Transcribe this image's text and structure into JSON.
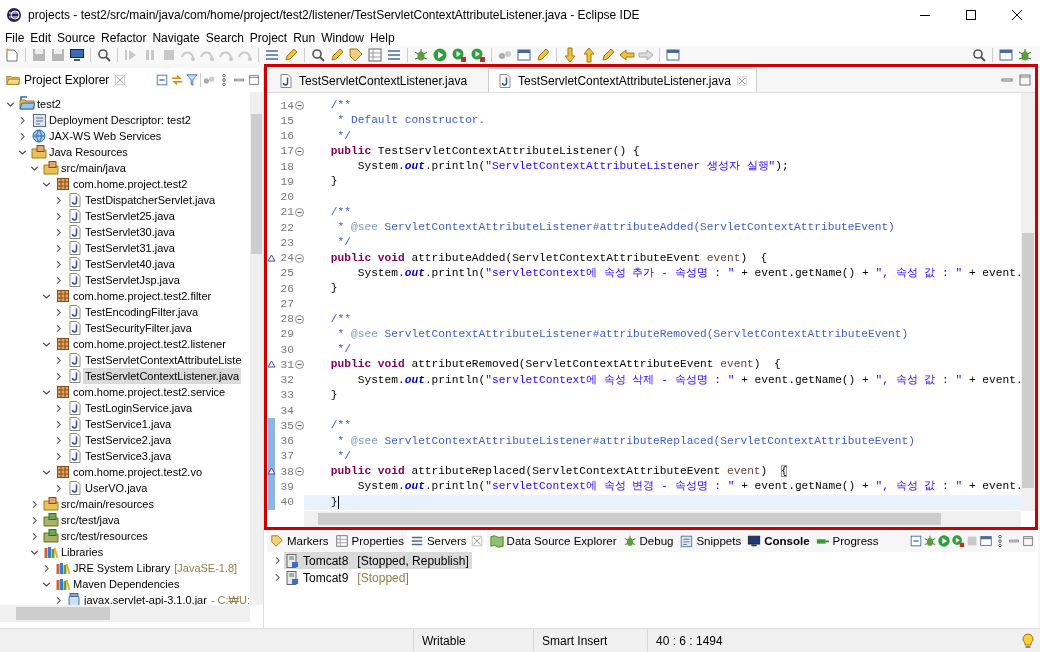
{
  "window": {
    "title": "projects - test2/src/main/java/com/home/project/test2/listener/TestServletContextAttributeListener.java - Eclipse IDE"
  },
  "menu": [
    "File",
    "Edit",
    "Source",
    "Refactor",
    "Navigate",
    "Search",
    "Project",
    "Run",
    "Window",
    "Help"
  ],
  "project_explorer": {
    "title": "Project Explorer",
    "tree": [
      {
        "label": "test2",
        "kind": "project",
        "expanded": true,
        "selected": false,
        "children": [
          {
            "label": "Deployment Descriptor: test2",
            "kind": "descriptor",
            "expanded": false,
            "selected": false
          },
          {
            "label": "JAX-WS Web Services",
            "kind": "webservices",
            "expanded": false,
            "selected": false
          },
          {
            "label": "Java Resources",
            "kind": "resources",
            "expanded": true,
            "selected": false,
            "children": [
              {
                "label": "src/main/java",
                "kind": "source-folder",
                "expanded": true,
                "selected": false,
                "children": [
                  {
                    "label": "com.home.project.test2",
                    "kind": "package",
                    "expanded": true,
                    "selected": false,
                    "children": [
                      {
                        "label": "TestDispatcherServlet.java",
                        "kind": "java",
                        "expanded": false,
                        "selected": false
                      },
                      {
                        "label": "TestServlet25.java",
                        "kind": "java",
                        "expanded": false,
                        "selected": false
                      },
                      {
                        "label": "TestServlet30.java",
                        "kind": "java",
                        "expanded": false,
                        "selected": false
                      },
                      {
                        "label": "TestServlet31.java",
                        "kind": "java",
                        "expanded": false,
                        "selected": false
                      },
                      {
                        "label": "TestServlet40.java",
                        "kind": "java",
                        "expanded": false,
                        "selected": false
                      },
                      {
                        "label": "TestServletJsp.java",
                        "kind": "java",
                        "expanded": false,
                        "selected": false
                      }
                    ]
                  },
                  {
                    "label": "com.home.project.test2.filter",
                    "kind": "package",
                    "expanded": true,
                    "selected": false,
                    "children": [
                      {
                        "label": "TestEncodingFilter.java",
                        "kind": "java",
                        "expanded": false,
                        "selected": false
                      },
                      {
                        "label": "TestSecurityFilter.java",
                        "kind": "java",
                        "expanded": false,
                        "selected": false
                      }
                    ]
                  },
                  {
                    "label": "com.home.project.test2.listener",
                    "kind": "package",
                    "expanded": true,
                    "selected": false,
                    "children": [
                      {
                        "label": "TestServletContextAttributeListe",
                        "kind": "java",
                        "expanded": false,
                        "selected": false
                      },
                      {
                        "label": "TestServletContextListener.java",
                        "kind": "java",
                        "expanded": false,
                        "selected": true
                      }
                    ]
                  },
                  {
                    "label": "com.home.project.test2.service",
                    "kind": "package",
                    "expanded": true,
                    "selected": false,
                    "children": [
                      {
                        "label": "TestLoginService.java",
                        "kind": "java",
                        "expanded": false,
                        "selected": false
                      },
                      {
                        "label": "TestService1.java",
                        "kind": "java",
                        "expanded": false,
                        "selected": false
                      },
                      {
                        "label": "TestService2.java",
                        "kind": "java",
                        "expanded": false,
                        "selected": false
                      },
                      {
                        "label": "TestService3.java",
                        "kind": "java",
                        "expanded": false,
                        "selected": false
                      }
                    ]
                  },
                  {
                    "label": "com.home.project.test2.vo",
                    "kind": "package",
                    "expanded": true,
                    "selected": false,
                    "children": [
                      {
                        "label": "UserVO.java",
                        "kind": "java",
                        "expanded": false,
                        "selected": false
                      }
                    ]
                  }
                ]
              },
              {
                "label": "src/main/resources",
                "kind": "source-folder",
                "expanded": false,
                "selected": false
              },
              {
                "label": "src/test/java",
                "kind": "test-folder",
                "expanded": false,
                "selected": false
              },
              {
                "label": "src/test/resources",
                "kind": "test-folder",
                "expanded": false,
                "selected": false
              },
              {
                "label": "Libraries",
                "kind": "libraries",
                "expanded": true,
                "selected": false,
                "children": [
                  {
                    "label": "JRE System Library",
                    "decoration": "[JavaSE-1.8]",
                    "kind": "library",
                    "expanded": false,
                    "selected": false
                  },
                  {
                    "label": "Maven Dependencies",
                    "kind": "library",
                    "expanded": true,
                    "selected": false,
                    "children": [
                      {
                        "label": "javax.servlet-api-3.1.0.jar",
                        "decoration": "- C:₩U:",
                        "kind": "jar",
                        "expanded": false,
                        "selected": false
                      }
                    ]
                  }
                ]
              }
            ]
          }
        ]
      }
    ]
  },
  "editor": {
    "tabs": [
      {
        "label": "TestServletContextListener.java",
        "selected": false
      },
      {
        "label": "TestServletContextAttributeListener.java",
        "selected": true
      }
    ],
    "lines": [
      {
        "number": "14",
        "foldable": true,
        "override": false,
        "changed": false,
        "current": false,
        "tokens": [
          {
            "kind": "comment",
            "text": "    /**"
          }
        ]
      },
      {
        "number": "15",
        "foldable": false,
        "override": false,
        "changed": false,
        "current": false,
        "tokens": [
          {
            "kind": "comment",
            "text": "     * Default constructor."
          }
        ]
      },
      {
        "number": "16",
        "foldable": false,
        "override": false,
        "changed": false,
        "current": false,
        "tokens": [
          {
            "kind": "comment",
            "text": "     */"
          }
        ]
      },
      {
        "number": "17",
        "foldable": true,
        "override": false,
        "changed": false,
        "current": false,
        "tokens": [
          {
            "kind": "keyword",
            "text": "    public"
          },
          {
            "kind": "plain",
            "text": " TestServletContextAttributeListener() {"
          }
        ]
      },
      {
        "number": "18",
        "foldable": false,
        "override": false,
        "changed": false,
        "current": false,
        "tokens": [
          {
            "kind": "plain",
            "text": "        System."
          },
          {
            "kind": "static",
            "text": "out"
          },
          {
            "kind": "plain",
            "text": ".println("
          },
          {
            "kind": "string",
            "text": "\"ServletContextAttributeListener 생성자 실행\""
          },
          {
            "kind": "plain",
            "text": ");"
          }
        ]
      },
      {
        "number": "19",
        "foldable": false,
        "override": false,
        "changed": false,
        "current": false,
        "tokens": [
          {
            "kind": "plain",
            "text": "    }"
          }
        ]
      },
      {
        "number": "20",
        "foldable": false,
        "override": false,
        "changed": false,
        "current": false
      },
      {
        "number": "21",
        "foldable": true,
        "override": false,
        "changed": false,
        "current": false,
        "tokens": [
          {
            "kind": "comment",
            "text": "    /**"
          }
        ]
      },
      {
        "number": "22",
        "foldable": false,
        "override": false,
        "changed": false,
        "current": false,
        "tokens": [
          {
            "kind": "comment",
            "text": "     * "
          },
          {
            "kind": "doc-tag",
            "text": "@see"
          },
          {
            "kind": "comment",
            "text": " ServletContextAttributeListener#attributeAdded(ServletContextAttributeEvent)"
          }
        ]
      },
      {
        "number": "23",
        "foldable": false,
        "override": false,
        "changed": false,
        "current": false,
        "tokens": [
          {
            "kind": "comment",
            "text": "     */"
          }
        ]
      },
      {
        "number": "24",
        "foldable": true,
        "override": true,
        "changed": false,
        "current": false,
        "tokens": [
          {
            "kind": "keyword",
            "text": "    public void"
          },
          {
            "kind": "plain",
            "text": " attributeAdded(ServletContextAttributeEvent "
          },
          {
            "kind": "param",
            "text": "event"
          },
          {
            "kind": "plain",
            "text": ")  {"
          }
        ]
      },
      {
        "number": "25",
        "foldable": false,
        "override": false,
        "changed": false,
        "current": false,
        "tokens": [
          {
            "kind": "plain",
            "text": "        System."
          },
          {
            "kind": "static",
            "text": "out"
          },
          {
            "kind": "plain",
            "text": ".println("
          },
          {
            "kind": "string",
            "text": "\"servletContext에 속성 추가 - 속성명 : \""
          },
          {
            "kind": "plain",
            "text": " + event.getName() + "
          },
          {
            "kind": "string",
            "text": "\", 속성 값 : \""
          },
          {
            "kind": "plain",
            "text": " + event."
          }
        ]
      },
      {
        "number": "26",
        "foldable": false,
        "override": false,
        "changed": false,
        "current": false,
        "tokens": [
          {
            "kind": "plain",
            "text": "    }"
          }
        ]
      },
      {
        "number": "27",
        "foldable": false,
        "override": false,
        "changed": false,
        "current": false
      },
      {
        "number": "28",
        "foldable": true,
        "override": false,
        "changed": false,
        "current": false,
        "tokens": [
          {
            "kind": "comment",
            "text": "    /**"
          }
        ]
      },
      {
        "number": "29",
        "foldable": false,
        "override": false,
        "changed": false,
        "current": false,
        "tokens": [
          {
            "kind": "comment",
            "text": "     * "
          },
          {
            "kind": "doc-tag",
            "text": "@see"
          },
          {
            "kind": "comment",
            "text": " ServletContextAttributeListener#attributeRemoved(ServletContextAttributeEvent)"
          }
        ]
      },
      {
        "number": "30",
        "foldable": false,
        "override": false,
        "changed": false,
        "current": false,
        "tokens": [
          {
            "kind": "comment",
            "text": "     */"
          }
        ]
      },
      {
        "number": "31",
        "foldable": true,
        "override": true,
        "changed": false,
        "current": false,
        "tokens": [
          {
            "kind": "keyword",
            "text": "    public void"
          },
          {
            "kind": "plain",
            "text": " attributeRemoved(ServletContextAttributeEvent "
          },
          {
            "kind": "param",
            "text": "event"
          },
          {
            "kind": "plain",
            "text": ")  {"
          }
        ]
      },
      {
        "number": "32",
        "foldable": false,
        "override": false,
        "changed": false,
        "current": false,
        "tokens": [
          {
            "kind": "plain",
            "text": "        System."
          },
          {
            "kind": "static",
            "text": "out"
          },
          {
            "kind": "plain",
            "text": ".println("
          },
          {
            "kind": "string",
            "text": "\"servletContext에 속성 삭제 - 속성명 : \""
          },
          {
            "kind": "plain",
            "text": " + event.getName() + "
          },
          {
            "kind": "string",
            "text": "\", 속성 값 : \""
          },
          {
            "kind": "plain",
            "text": " + event."
          }
        ]
      },
      {
        "number": "33",
        "foldable": false,
        "override": false,
        "changed": false,
        "current": false,
        "tokens": [
          {
            "kind": "plain",
            "text": "    }"
          }
        ]
      },
      {
        "number": "34",
        "foldable": false,
        "override": false,
        "changed": false,
        "current": false
      },
      {
        "number": "35",
        "foldable": true,
        "override": false,
        "changed": true,
        "current": false,
        "tokens": [
          {
            "kind": "comment",
            "text": "    /**"
          }
        ]
      },
      {
        "number": "36",
        "foldable": false,
        "override": false,
        "changed": true,
        "current": false,
        "tokens": [
          {
            "kind": "comment",
            "text": "     * "
          },
          {
            "kind": "doc-tag",
            "text": "@see"
          },
          {
            "kind": "comment",
            "text": " ServletContextAttributeListener#attributeReplaced(ServletContextAttributeEvent)"
          }
        ]
      },
      {
        "number": "37",
        "foldable": false,
        "override": false,
        "changed": true,
        "current": false,
        "tokens": [
          {
            "kind": "comment",
            "text": "     */"
          }
        ]
      },
      {
        "number": "38",
        "foldable": true,
        "override": true,
        "changed": true,
        "current": false,
        "tokens": [
          {
            "kind": "keyword",
            "text": "    public void"
          },
          {
            "kind": "plain",
            "text": " attributeReplaced(ServletContextAttributeEvent "
          },
          {
            "kind": "param",
            "text": "event"
          },
          {
            "kind": "plain",
            "text": ")  "
          },
          {
            "kind": "bracket-match",
            "text": "{"
          }
        ]
      },
      {
        "number": "39",
        "foldable": false,
        "override": false,
        "changed": true,
        "current": false,
        "tokens": [
          {
            "kind": "plain",
            "text": "        System."
          },
          {
            "kind": "static",
            "text": "out"
          },
          {
            "kind": "plain",
            "text": ".println("
          },
          {
            "kind": "string",
            "text": "\"servletContext에 속성 변경 - 속성명 : \""
          },
          {
            "kind": "plain",
            "text": " + event.getName() + "
          },
          {
            "kind": "string",
            "text": "\", 속성 값 : \""
          },
          {
            "kind": "plain",
            "text": " + event."
          }
        ]
      },
      {
        "number": "40",
        "foldable": false,
        "override": false,
        "changed": true,
        "current": true,
        "tokens": [
          {
            "kind": "plain",
            "text": "    }"
          }
        ]
      }
    ]
  },
  "bottom_panel": {
    "tabs": [
      {
        "label": "Markers",
        "selected": false,
        "highlighted": false
      },
      {
        "label": "Properties",
        "selected": false,
        "highlighted": false
      },
      {
        "label": "Servers",
        "selected": true,
        "highlighted": false
      },
      {
        "label": "Data Source Explorer",
        "selected": false,
        "highlighted": false
      },
      {
        "label": "Debug",
        "selected": false,
        "highlighted": false
      },
      {
        "label": "Snippets",
        "selected": false,
        "highlighted": false
      },
      {
        "label": "Console",
        "selected": false,
        "highlighted": true
      },
      {
        "label": "Progress",
        "selected": false,
        "highlighted": false
      }
    ],
    "servers": [
      {
        "name": "Tomcat8",
        "status": "[Stopped, Republish]",
        "selected": true
      },
      {
        "name": "Tomcat9",
        "status": "[Stopped]",
        "selected": false
      }
    ]
  },
  "status_bar": [
    "Writable",
    "Smart Insert",
    "40 : 6 : 1494"
  ]
}
